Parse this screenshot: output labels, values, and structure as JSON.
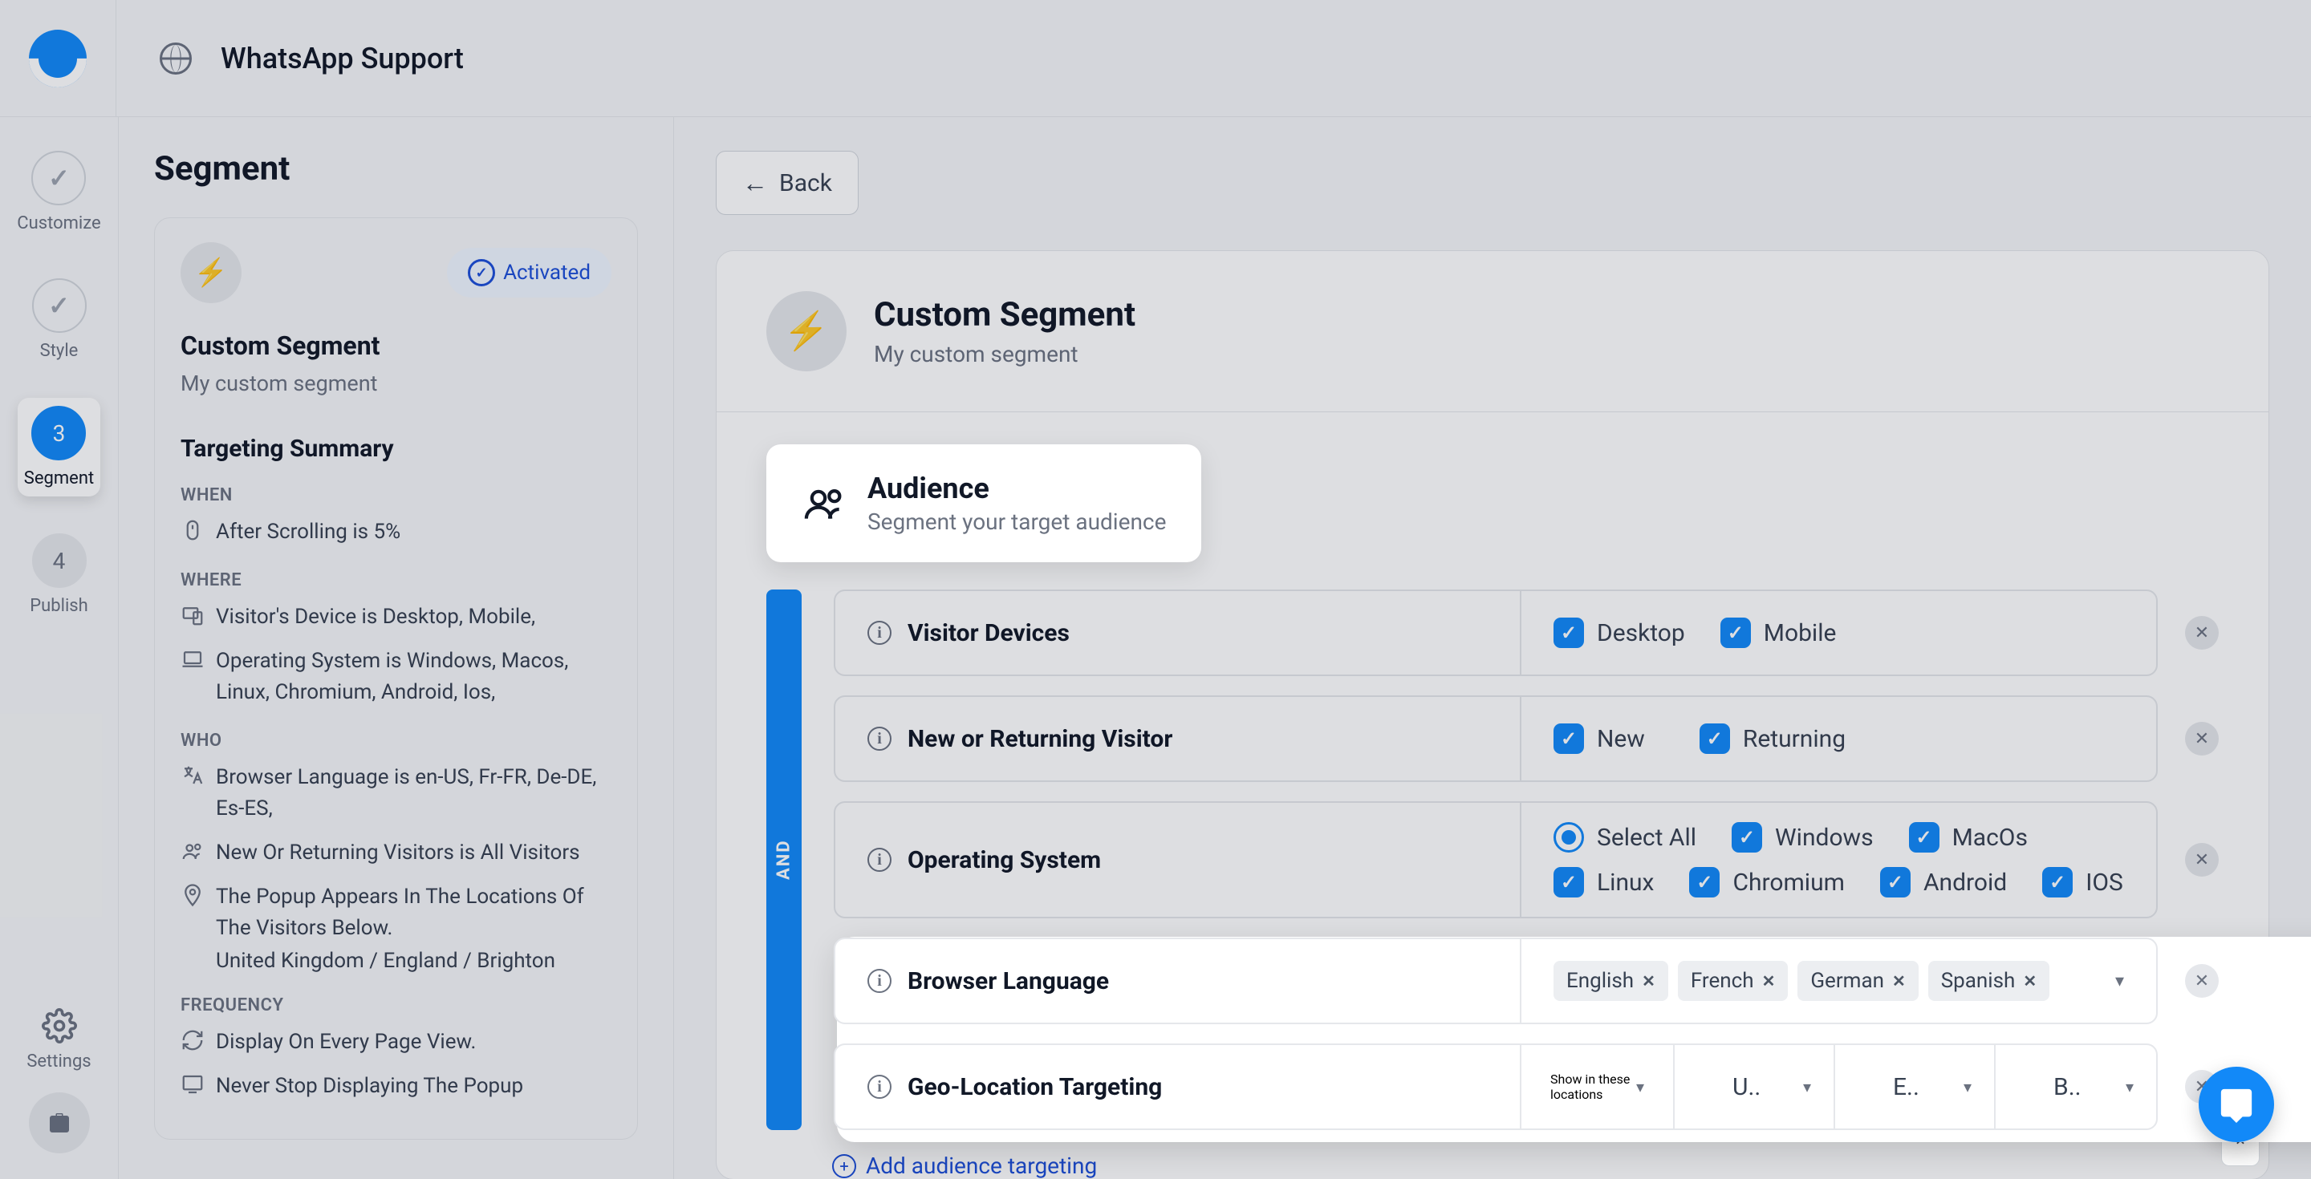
{
  "header": {
    "title": "WhatsApp Support"
  },
  "steps": {
    "customize": "Customize",
    "style": "Style",
    "segment_num": "3",
    "segment": "Segment",
    "publish_num": "4",
    "publish": "Publish",
    "settings": "Settings"
  },
  "panel": {
    "title": "Segment",
    "activated": "Activated",
    "segment_name": "Custom Segment",
    "segment_desc": "My custom segment",
    "targeting_heading": "Targeting Summary",
    "when_label": "WHEN",
    "when_text": "After Scrolling is 5%",
    "where_label": "WHERE",
    "where_device": "Visitor's Device is Desktop, Mobile,",
    "where_os": "Operating System is Windows, Macos, Linux, Chromium, Android, Ios,",
    "who_label": "WHO",
    "who_lang": "Browser Language is en-US, Fr-FR, De-DE, Es-ES,",
    "who_newret": "New Or Returning Visitors is All Visitors",
    "who_geo": "The Popup Appears In The Locations Of The Visitors Below.",
    "who_geo2": "United Kingdom / England / Brighton",
    "freq_label": "FREQUENCY",
    "freq_every": "Display On Every Page View.",
    "freq_never": "Never Stop Displaying The Popup"
  },
  "main": {
    "back": "Back",
    "hero_title": "Custom Segment",
    "hero_sub": "My custom segment",
    "audience_title": "Audience",
    "audience_sub": "Segment your target audience",
    "and_label": "AND",
    "rules": {
      "visitor_devices": "Visitor Devices",
      "desktop": "Desktop",
      "mobile": "Mobile",
      "new_returning": "New or Returning Visitor",
      "new": "New",
      "returning": "Returning",
      "operating_system": "Operating System",
      "select_all": "Select All",
      "windows": "Windows",
      "macos": "MacOs",
      "linux": "Linux",
      "chromium": "Chromium",
      "android": "Android",
      "ios": "IOS",
      "browser_language": "Browser Language",
      "languages": {
        "english": "English",
        "french": "French",
        "german": "German",
        "spanish": "Spanish"
      },
      "geo": "Geo-Location Targeting",
      "show_in": "Show in these locations",
      "geo1": "U..",
      "geo2": "E..",
      "geo3": "B.."
    },
    "add_targeting": "Add audience targeting"
  }
}
